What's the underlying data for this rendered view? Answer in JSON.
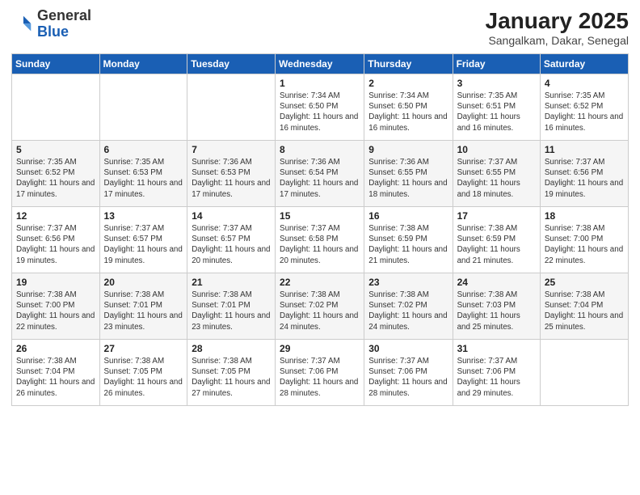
{
  "logo": {
    "general": "General",
    "blue": "Blue"
  },
  "header": {
    "month": "January 2025",
    "location": "Sangalkam, Dakar, Senegal"
  },
  "weekdays": [
    "Sunday",
    "Monday",
    "Tuesday",
    "Wednesday",
    "Thursday",
    "Friday",
    "Saturday"
  ],
  "weeks": [
    [
      {
        "day": "",
        "info": ""
      },
      {
        "day": "",
        "info": ""
      },
      {
        "day": "",
        "info": ""
      },
      {
        "day": "1",
        "info": "Sunrise: 7:34 AM\nSunset: 6:50 PM\nDaylight: 11 hours and 16 minutes."
      },
      {
        "day": "2",
        "info": "Sunrise: 7:34 AM\nSunset: 6:50 PM\nDaylight: 11 hours and 16 minutes."
      },
      {
        "day": "3",
        "info": "Sunrise: 7:35 AM\nSunset: 6:51 PM\nDaylight: 11 hours and 16 minutes."
      },
      {
        "day": "4",
        "info": "Sunrise: 7:35 AM\nSunset: 6:52 PM\nDaylight: 11 hours and 16 minutes."
      }
    ],
    [
      {
        "day": "5",
        "info": "Sunrise: 7:35 AM\nSunset: 6:52 PM\nDaylight: 11 hours and 17 minutes."
      },
      {
        "day": "6",
        "info": "Sunrise: 7:35 AM\nSunset: 6:53 PM\nDaylight: 11 hours and 17 minutes."
      },
      {
        "day": "7",
        "info": "Sunrise: 7:36 AM\nSunset: 6:53 PM\nDaylight: 11 hours and 17 minutes."
      },
      {
        "day": "8",
        "info": "Sunrise: 7:36 AM\nSunset: 6:54 PM\nDaylight: 11 hours and 17 minutes."
      },
      {
        "day": "9",
        "info": "Sunrise: 7:36 AM\nSunset: 6:55 PM\nDaylight: 11 hours and 18 minutes."
      },
      {
        "day": "10",
        "info": "Sunrise: 7:37 AM\nSunset: 6:55 PM\nDaylight: 11 hours and 18 minutes."
      },
      {
        "day": "11",
        "info": "Sunrise: 7:37 AM\nSunset: 6:56 PM\nDaylight: 11 hours and 19 minutes."
      }
    ],
    [
      {
        "day": "12",
        "info": "Sunrise: 7:37 AM\nSunset: 6:56 PM\nDaylight: 11 hours and 19 minutes."
      },
      {
        "day": "13",
        "info": "Sunrise: 7:37 AM\nSunset: 6:57 PM\nDaylight: 11 hours and 19 minutes."
      },
      {
        "day": "14",
        "info": "Sunrise: 7:37 AM\nSunset: 6:57 PM\nDaylight: 11 hours and 20 minutes."
      },
      {
        "day": "15",
        "info": "Sunrise: 7:37 AM\nSunset: 6:58 PM\nDaylight: 11 hours and 20 minutes."
      },
      {
        "day": "16",
        "info": "Sunrise: 7:38 AM\nSunset: 6:59 PM\nDaylight: 11 hours and 21 minutes."
      },
      {
        "day": "17",
        "info": "Sunrise: 7:38 AM\nSunset: 6:59 PM\nDaylight: 11 hours and 21 minutes."
      },
      {
        "day": "18",
        "info": "Sunrise: 7:38 AM\nSunset: 7:00 PM\nDaylight: 11 hours and 22 minutes."
      }
    ],
    [
      {
        "day": "19",
        "info": "Sunrise: 7:38 AM\nSunset: 7:00 PM\nDaylight: 11 hours and 22 minutes."
      },
      {
        "day": "20",
        "info": "Sunrise: 7:38 AM\nSunset: 7:01 PM\nDaylight: 11 hours and 23 minutes."
      },
      {
        "day": "21",
        "info": "Sunrise: 7:38 AM\nSunset: 7:01 PM\nDaylight: 11 hours and 23 minutes."
      },
      {
        "day": "22",
        "info": "Sunrise: 7:38 AM\nSunset: 7:02 PM\nDaylight: 11 hours and 24 minutes."
      },
      {
        "day": "23",
        "info": "Sunrise: 7:38 AM\nSunset: 7:02 PM\nDaylight: 11 hours and 24 minutes."
      },
      {
        "day": "24",
        "info": "Sunrise: 7:38 AM\nSunset: 7:03 PM\nDaylight: 11 hours and 25 minutes."
      },
      {
        "day": "25",
        "info": "Sunrise: 7:38 AM\nSunset: 7:04 PM\nDaylight: 11 hours and 25 minutes."
      }
    ],
    [
      {
        "day": "26",
        "info": "Sunrise: 7:38 AM\nSunset: 7:04 PM\nDaylight: 11 hours and 26 minutes."
      },
      {
        "day": "27",
        "info": "Sunrise: 7:38 AM\nSunset: 7:05 PM\nDaylight: 11 hours and 26 minutes."
      },
      {
        "day": "28",
        "info": "Sunrise: 7:38 AM\nSunset: 7:05 PM\nDaylight: 11 hours and 27 minutes."
      },
      {
        "day": "29",
        "info": "Sunrise: 7:37 AM\nSunset: 7:06 PM\nDaylight: 11 hours and 28 minutes."
      },
      {
        "day": "30",
        "info": "Sunrise: 7:37 AM\nSunset: 7:06 PM\nDaylight: 11 hours and 28 minutes."
      },
      {
        "day": "31",
        "info": "Sunrise: 7:37 AM\nSunset: 7:06 PM\nDaylight: 11 hours and 29 minutes."
      },
      {
        "day": "",
        "info": ""
      }
    ]
  ]
}
